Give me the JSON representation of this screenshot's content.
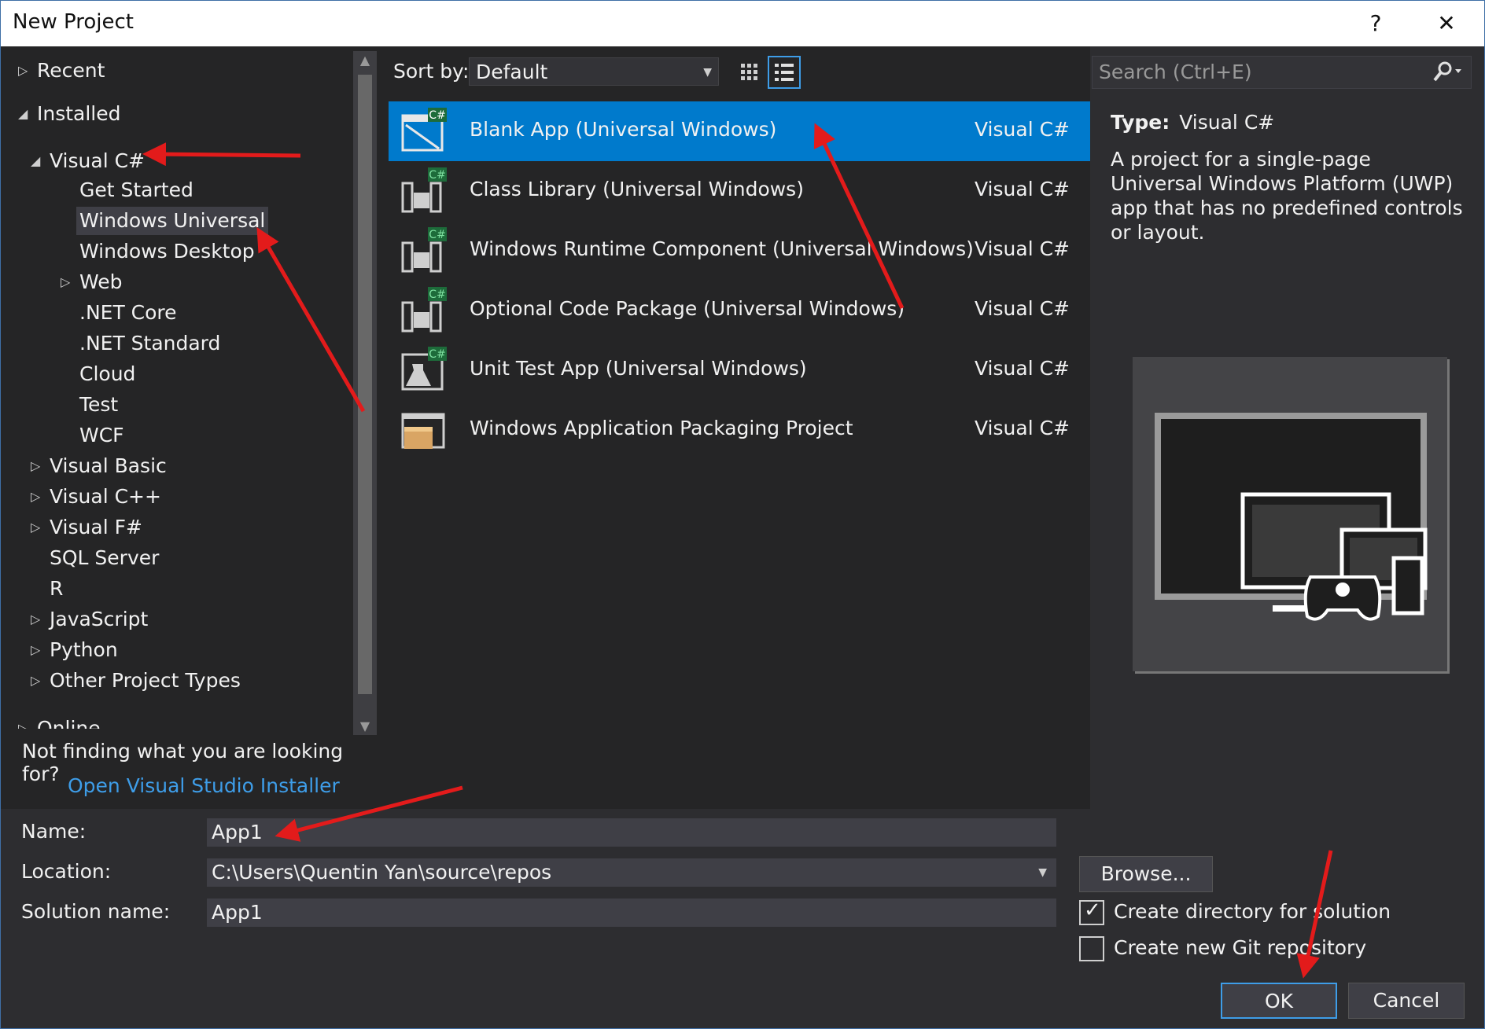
{
  "window": {
    "title": "New Project",
    "help_label": "?",
    "close_label": "✕"
  },
  "tree": {
    "items": [
      {
        "label": "Recent",
        "expander": "▷"
      },
      {
        "label": "Installed",
        "expander": "◢"
      },
      {
        "label": "Visual C#",
        "expander": "◢"
      },
      {
        "label": "Get Started",
        "expander": ""
      },
      {
        "label": "Windows Universal",
        "expander": ""
      },
      {
        "label": "Windows Desktop",
        "expander": ""
      },
      {
        "label": "Web",
        "expander": "▷"
      },
      {
        "label": ".NET Core",
        "expander": ""
      },
      {
        "label": ".NET Standard",
        "expander": ""
      },
      {
        "label": "Cloud",
        "expander": ""
      },
      {
        "label": "Test",
        "expander": ""
      },
      {
        "label": "WCF",
        "expander": ""
      },
      {
        "label": "Visual Basic",
        "expander": "▷"
      },
      {
        "label": "Visual C++",
        "expander": "▷"
      },
      {
        "label": "Visual F#",
        "expander": "▷"
      },
      {
        "label": "SQL Server",
        "expander": ""
      },
      {
        "label": "R",
        "expander": ""
      },
      {
        "label": "JavaScript",
        "expander": "▷"
      },
      {
        "label": "Python",
        "expander": "▷"
      },
      {
        "label": "Other Project Types",
        "expander": "▷"
      },
      {
        "label": "Online",
        "expander": "▷"
      }
    ],
    "not_finding": "Not finding what you are looking for?",
    "installer_link": "Open Visual Studio Installer"
  },
  "sort": {
    "label": "Sort by:",
    "value": "Default"
  },
  "templates": [
    {
      "name": "Blank App (Universal Windows)",
      "lang": "Visual C#"
    },
    {
      "name": "Class Library (Universal Windows)",
      "lang": "Visual C#"
    },
    {
      "name": "Windows Runtime Component (Universal Windows)",
      "lang": "Visual C#"
    },
    {
      "name": "Optional Code Package (Universal Windows)",
      "lang": "Visual C#"
    },
    {
      "name": "Unit Test App (Universal Windows)",
      "lang": "Visual C#"
    },
    {
      "name": "Windows Application Packaging Project",
      "lang": "Visual C#"
    }
  ],
  "search": {
    "placeholder": "Search (Ctrl+E)"
  },
  "details": {
    "type_label": "Type:",
    "type_value": "Visual C#",
    "description": "A project for a single-page Universal Windows Platform (UWP) app that has no predefined controls or layout."
  },
  "form": {
    "name_label": "Name:",
    "name_value": "App1",
    "location_label": "Location:",
    "location_value": "C:\\Users\\Quentin Yan\\source\\repos",
    "solution_label": "Solution name:",
    "solution_value": "App1",
    "browse_label": "Browse...",
    "create_dir_label": "Create directory for solution",
    "create_dir_checked": true,
    "git_label": "Create new Git repository",
    "git_checked": false,
    "ok_label": "OK",
    "cancel_label": "Cancel"
  },
  "colors": {
    "accent": "#007acc",
    "link": "#3e9de8",
    "annotation_arrow": "#e31b1b",
    "background": "#252526"
  }
}
